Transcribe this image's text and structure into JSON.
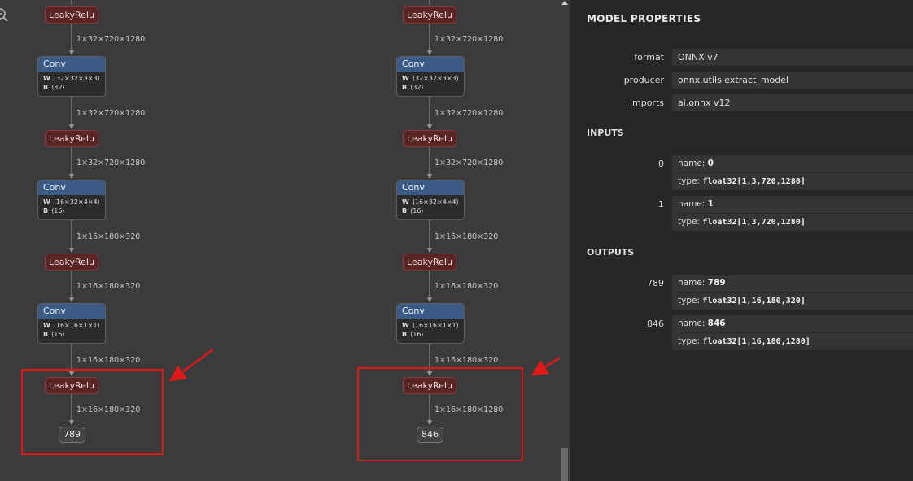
{
  "graph": {
    "left_column": {
      "nodes": [
        {
          "type": "LeakyRelu",
          "label": "LeakyRelu"
        },
        {
          "type": "Conv",
          "label": "Conv",
          "w": "⟨32×32×3×3⟩",
          "b": "⟨32⟩"
        },
        {
          "type": "LeakyRelu",
          "label": "LeakyRelu"
        },
        {
          "type": "Conv",
          "label": "Conv",
          "w": "⟨16×32×4×4⟩",
          "b": "⟨16⟩"
        },
        {
          "type": "LeakyRelu",
          "label": "LeakyRelu"
        },
        {
          "type": "Conv",
          "label": "Conv",
          "w": "⟨16×16×1×1⟩",
          "b": "⟨16⟩"
        },
        {
          "type": "LeakyRelu",
          "label": "LeakyRelu"
        }
      ],
      "edges": [
        "1×32×720×1280",
        "1×32×720×1280",
        "1×32×720×1280",
        "1×16×180×320",
        "1×16×180×320",
        "1×16×180×320",
        "1×16×180×320"
      ],
      "output": "789"
    },
    "right_column": {
      "nodes": [
        {
          "type": "LeakyRelu",
          "label": "LeakyRelu"
        },
        {
          "type": "Conv",
          "label": "Conv",
          "w": "⟨32×32×3×3⟩",
          "b": "⟨32⟩"
        },
        {
          "type": "LeakyRelu",
          "label": "LeakyRelu"
        },
        {
          "type": "Conv",
          "label": "Conv",
          "w": "⟨16×32×4×4⟩",
          "b": "⟨16⟩"
        },
        {
          "type": "LeakyRelu",
          "label": "LeakyRelu"
        },
        {
          "type": "Conv",
          "label": "Conv",
          "w": "⟨16×16×1×1⟩",
          "b": "⟨16⟩"
        },
        {
          "type": "LeakyRelu",
          "label": "LeakyRelu"
        }
      ],
      "edges": [
        "1×32×720×1280",
        "1×32×720×1280",
        "1×32×720×1280",
        "1×16×180×320",
        "1×16×180×320",
        "1×16×180×320",
        "1×16×180×1280"
      ],
      "output": "846"
    },
    "w_key": "W",
    "b_key": "B",
    "annotation_color": "#e01818"
  },
  "properties": {
    "title": "MODEL PROPERTIES",
    "fields": [
      {
        "label": "format",
        "value": "ONNX v7"
      },
      {
        "label": "producer",
        "value": "onnx.utils.extract_model"
      },
      {
        "label": "imports",
        "value": "ai.onnx v12"
      }
    ],
    "inputs_title": "INPUTS",
    "inputs": [
      {
        "index": "0",
        "name_key": "name:",
        "name": "0",
        "type_key": "type:",
        "type": "float32[1,3,720,1280]"
      },
      {
        "index": "1",
        "name_key": "name:",
        "name": "1",
        "type_key": "type:",
        "type": "float32[1,3,720,1280]"
      }
    ],
    "outputs_title": "OUTPUTS",
    "outputs": [
      {
        "index": "789",
        "name_key": "name:",
        "name": "789",
        "type_key": "type:",
        "type": "float32[1,16,180,320]"
      },
      {
        "index": "846",
        "name_key": "name:",
        "name": "846",
        "type_key": "type:",
        "type": "float32[1,16,180,1280]"
      }
    ]
  }
}
